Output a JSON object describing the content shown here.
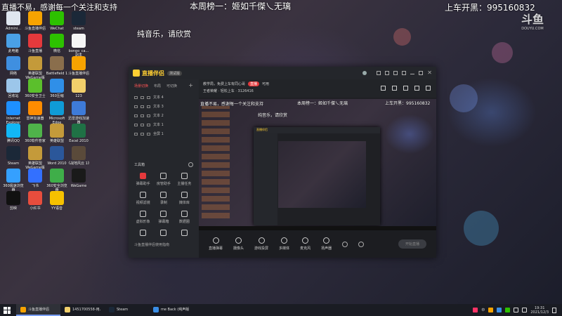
{
  "overlay": {
    "top_left": "直播不易，感谢每一个关注和支持",
    "weekly": "本周榜一：姬如千傑乀无璃",
    "car": "上车开黑：995160832",
    "watermark": "斗鱼",
    "watermark_sub": "DOUYU.COM",
    "music": "纯音乐，请欣赏"
  },
  "desktop_icons": [
    {
      "label": "Admini...",
      "color": "#dfe6f0"
    },
    {
      "label": "斗鱼直播伴侣",
      "color": "#f7a300"
    },
    {
      "label": "WeChat",
      "color": "#2dc100"
    },
    {
      "label": "steam",
      "color": "#1b2838"
    },
    {
      "label": "此电脑",
      "color": "#4aa0e6"
    },
    {
      "label": "斗鱼直播",
      "color": "#e4393c"
    },
    {
      "label": "微信",
      "color": "#2dc100"
    },
    {
      "label": "bongo_ca... 副本",
      "color": "#f5f5f5"
    },
    {
      "label": "网络",
      "color": "#3f8fe0"
    },
    {
      "label": "英雄联盟 WeGame版",
      "color": "#c49a3a"
    },
    {
      "label": "Battlefield 1",
      "color": "#8a6e4c"
    },
    {
      "label": "斗鱼直播伴侣",
      "color": "#f7a300"
    },
    {
      "label": "回收站",
      "color": "#9cc6ea"
    },
    {
      "label": "360安全卫士",
      "color": "#5bbf2c"
    },
    {
      "label": "360压缩",
      "color": "#2f8fe8"
    },
    {
      "label": "123",
      "color": "#f2d06b"
    },
    {
      "label": "Internet Explorer",
      "color": "#1e90ff"
    },
    {
      "label": "雷神加速器",
      "color": "#ff8c00"
    },
    {
      "label": "Microsoft Edge",
      "color": "#0f9bd7"
    },
    {
      "label": "迅雷游戏加速器",
      "color": "#3e7bd8"
    },
    {
      "label": "腾讯QQ",
      "color": "#12b7f5"
    },
    {
      "label": "360软件管家",
      "color": "#4fb34a"
    },
    {
      "label": "英雄联盟",
      "color": "#c49a3a"
    },
    {
      "label": "Excel 2010",
      "color": "#1f7145"
    },
    {
      "label": "Steam",
      "color": "#1b2838"
    },
    {
      "label": "英雄联盟WeGame版",
      "color": "#c49a3a"
    },
    {
      "label": "Word 2010",
      "color": "#2b579a"
    },
    {
      "label": "《战地风云 1》",
      "color": "#5a4a3a"
    },
    {
      "label": "360极速浏览器",
      "color": "#35a0ff"
    },
    {
      "label": "飞书",
      "color": "#3370ff"
    },
    {
      "label": "360安全浏览器",
      "color": "#3fae49"
    },
    {
      "label": "WeGame",
      "color": "#1a1a1a"
    },
    {
      "label": "剪映",
      "color": "#111111"
    },
    {
      "label": "小红书",
      "color": "#e84d3d"
    },
    {
      "label": "YY语音",
      "color": "#f6c100"
    }
  ],
  "app": {
    "logo": "直播伴侣",
    "version": "测试版",
    "left_tabs": [
      "场景切换",
      "布局",
      "可切换"
    ],
    "scenes": [
      "文本 4",
      "文本 3",
      "文本 2",
      "文本 1",
      "全屏 1"
    ],
    "tools_title": "工具箱",
    "tools": [
      "弹幕助手",
      "房管助手",
      "主播任务",
      "视频滤镜",
      "录制",
      "媒体库",
      "虚拟形象",
      "弹幕箱",
      "数据圈",
      "",
      "",
      ""
    ],
    "tools_footer": "斗鱼直播伴侣使用指南",
    "stream_title": "教学局，免费上车有同心哥",
    "status_pill": "直播",
    "status_text": "可用",
    "info_line": "王者荣耀 · 轻松上车 · 3126416",
    "bottom_actions": [
      "直播弹幕",
      "摄像头",
      "游戏投屏",
      "多媒体",
      "麦克风",
      "扬声器"
    ],
    "start_button": "开始直播",
    "preview_top_left": "直播不易，感谢每一个关注和支持",
    "preview_weekly": "本周榜一：姬如千傑乀无璃",
    "preview_car": "上车开黑：995160832",
    "preview_music": "纯音乐，请欣赏",
    "preview_logo": "直播伴侣"
  },
  "taskbar": {
    "items": [
      {
        "label": "斗鱼直播伴侣",
        "color": "#f7a300",
        "active": true
      },
      {
        "label": "1451700558-用人...",
        "color": "#f2d06b",
        "active": false
      },
      {
        "label": "Steam",
        "color": "#1b2838",
        "active": false
      },
      {
        "label": "me Back (纯声版) ...",
        "color": "#3a8ee6",
        "active": false
      }
    ],
    "ime": "中",
    "time": "19:31",
    "date": "2021/12/3"
  }
}
